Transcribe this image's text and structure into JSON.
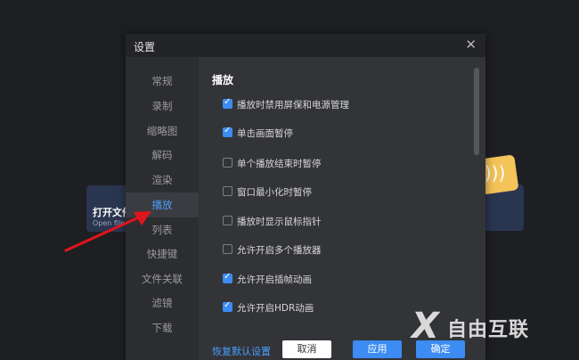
{
  "background": {
    "open_card_title": "打开文件",
    "open_card_sub": "Open file"
  },
  "dialog": {
    "title": "设置",
    "close_glyph": "✕",
    "nav": [
      {
        "label": "常规"
      },
      {
        "label": "录制"
      },
      {
        "label": "缩略图"
      },
      {
        "label": "解码"
      },
      {
        "label": "渲染"
      },
      {
        "label": "播放",
        "active": true
      },
      {
        "label": "列表"
      },
      {
        "label": "快捷键"
      },
      {
        "label": "文件关联"
      },
      {
        "label": "滤镜"
      },
      {
        "label": "下载"
      }
    ],
    "section_title": "播放",
    "options": [
      {
        "label": "播放时禁用屏保和电源管理",
        "checked": true
      },
      {
        "label": "单击画面暂停",
        "checked": true
      },
      {
        "label": "单个播放结束时暂停",
        "checked": false
      },
      {
        "label": "窗口最小化时暂停",
        "checked": false
      },
      {
        "label": "播放时显示鼠标指针",
        "checked": false
      },
      {
        "label": "允许开启多个播放器",
        "checked": false
      },
      {
        "label": "允许开启插帧动画",
        "checked": true
      },
      {
        "label": "允许开启HDR动画",
        "checked": true
      }
    ],
    "restore_label": "恢复默认设置",
    "cancel_label": "取消",
    "apply_label": "应用",
    "ok_label": "确定"
  },
  "watermark": {
    "mark": "X",
    "text": "自由互联"
  },
  "colors": {
    "accent": "#3c8cf3",
    "active_text": "#4a9fff",
    "arrow": "#e0141b"
  }
}
